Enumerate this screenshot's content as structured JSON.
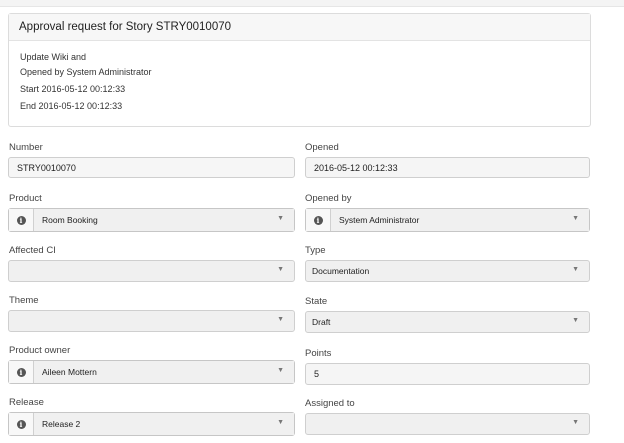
{
  "approval": {
    "title": "Approval request for Story STRY0010070",
    "lines": [
      "Update Wiki and",
      "Opened by System Administrator",
      "Start 2016-05-12 00:12:33",
      "End 2016-05-12 00:12:33"
    ]
  },
  "form": {
    "number": {
      "label": "Number",
      "value": "STRY0010070"
    },
    "opened": {
      "label": "Opened",
      "value": "2016-05-12 00:12:33"
    },
    "product": {
      "label": "Product",
      "value": "Room Booking"
    },
    "opened_by": {
      "label": "Opened by",
      "value": "System Administrator"
    },
    "affected_ci": {
      "label": "Affected CI",
      "value": ""
    },
    "type": {
      "label": "Type",
      "value": "Documentation"
    },
    "theme": {
      "label": "Theme",
      "value": ""
    },
    "state": {
      "label": "State",
      "value": "Draft"
    },
    "product_owner": {
      "label": "Product owner",
      "value": "Aileen Mottern"
    },
    "points": {
      "label": "Points",
      "value": "5"
    },
    "release": {
      "label": "Release",
      "value": "Release 2"
    },
    "assigned_to": {
      "label": "Assigned to",
      "value": ""
    }
  },
  "icons": {
    "info": "info-icon",
    "caret": "chevron-down-icon"
  },
  "glyphs": {
    "info": "i",
    "caret": "▼"
  }
}
